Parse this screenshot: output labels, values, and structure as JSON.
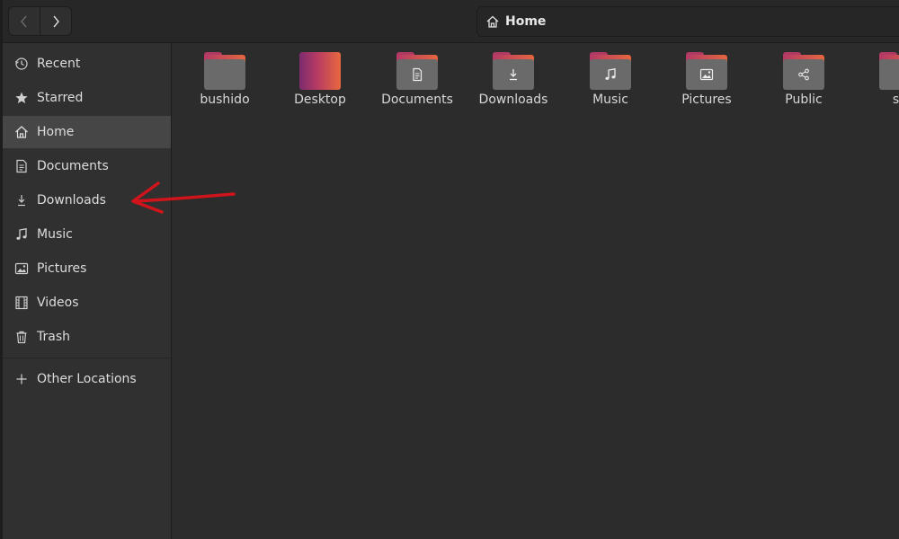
{
  "window": {
    "path": {
      "current": "Home"
    }
  },
  "sidebar": {
    "items": [
      {
        "label": "Recent",
        "icon": "clock-icon"
      },
      {
        "label": "Starred",
        "icon": "star-icon"
      },
      {
        "label": "Home",
        "icon": "home-icon",
        "active": true
      },
      {
        "label": "Documents",
        "icon": "document-icon"
      },
      {
        "label": "Downloads",
        "icon": "download-icon"
      },
      {
        "label": "Music",
        "icon": "music-note-icon"
      },
      {
        "label": "Pictures",
        "icon": "picture-icon"
      },
      {
        "label": "Videos",
        "icon": "film-icon"
      },
      {
        "label": "Trash",
        "icon": "trash-icon"
      }
    ],
    "other": {
      "label": "Other Locations",
      "icon": "plus-icon"
    }
  },
  "files": [
    {
      "label": "bushido",
      "icon": "folder-icon"
    },
    {
      "label": "Desktop",
      "icon": "desktop-folder-icon"
    },
    {
      "label": "Documents",
      "icon": "documents-folder-icon"
    },
    {
      "label": "Downloads",
      "icon": "downloads-folder-icon"
    },
    {
      "label": "Music",
      "icon": "music-folder-icon"
    },
    {
      "label": "Pictures",
      "icon": "pictures-folder-icon"
    },
    {
      "label": "Public",
      "icon": "public-folder-icon"
    },
    {
      "label": "sn",
      "icon": "folder-icon"
    }
  ],
  "colors": {
    "accent_start": "#b43a66",
    "accent_end": "#e6653f",
    "annotation": "#d0141b"
  }
}
